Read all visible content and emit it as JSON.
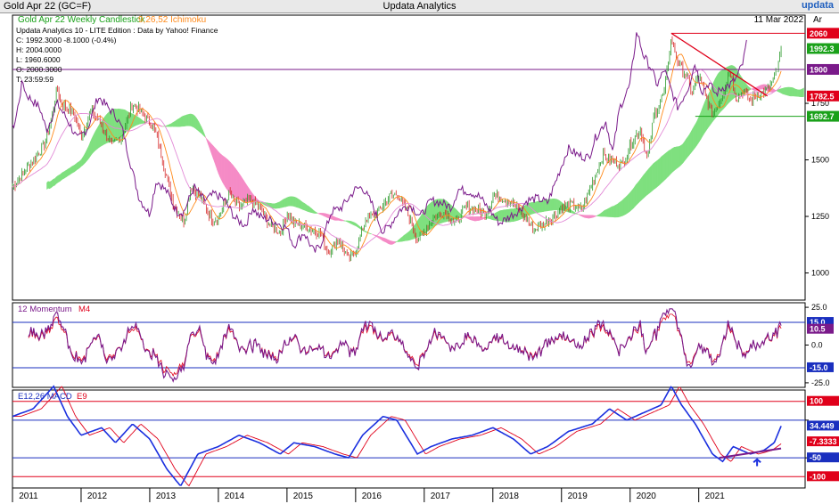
{
  "window": {
    "symbol": "Gold Apr 22 (GC=F)",
    "title": "Updata Analytics",
    "brand": "updata"
  },
  "chart_data": [
    {
      "type": "line",
      "panel": "price",
      "header": {
        "instrument": "Gold Apr 22 Weekly Candlestick",
        "indicator": "9,26,52 Ichimoku",
        "date": "11 Mar 2022",
        "scale_tag": "Ar"
      },
      "info_lines": [
        "Updata Analytics 10 - LITE Edition : Data by Yahoo! Finance",
        "C: 1992.3000  -8.1000 (-0.4%)",
        "H: 2004.0000",
        "L: 1960.6000",
        "O: 2000.3000",
        "T: 23:59:59"
      ],
      "y_ticks": [
        "1750",
        "1500",
        "1250",
        "1000"
      ],
      "y_tick_values": [
        1750,
        1500,
        1250,
        1000
      ],
      "ylim": [
        880,
        2140
      ],
      "markers": [
        {
          "label": "2060",
          "value": 2060,
          "color": "#e0001a"
        },
        {
          "label": "1992.3",
          "value": 1992.3,
          "color": "#1aa11a"
        },
        {
          "label": "1900",
          "value": 1900,
          "color": "#7a1a8a"
        },
        {
          "label": "1782.5",
          "value": 1782.5,
          "color": "#e0001a"
        },
        {
          "label": "1692.7",
          "value": 1692.7,
          "color": "#1aa11a"
        }
      ],
      "horizontal_lines": [
        {
          "value": 1900,
          "color": "#7a1a8a"
        },
        {
          "value": 2060,
          "color": "#e0001a"
        },
        {
          "value": 1692.7,
          "color": "#1aa11a"
        }
      ],
      "price_path": [
        [
          2011.0,
          1380
        ],
        [
          2011.1,
          1420
        ],
        [
          2011.3,
          1500
        ],
        [
          2011.45,
          1560
        ],
        [
          2011.55,
          1650
        ],
        [
          2011.65,
          1820
        ],
        [
          2011.7,
          1760
        ],
        [
          2011.9,
          1700
        ],
        [
          2012.0,
          1600
        ],
        [
          2012.15,
          1720
        ],
        [
          2012.3,
          1650
        ],
        [
          2012.45,
          1560
        ],
        [
          2012.6,
          1610
        ],
        [
          2012.75,
          1750
        ],
        [
          2012.9,
          1700
        ],
        [
          2013.0,
          1670
        ],
        [
          2013.1,
          1610
        ],
        [
          2013.25,
          1420
        ],
        [
          2013.35,
          1300
        ],
        [
          2013.5,
          1230
        ],
        [
          2013.6,
          1380
        ],
        [
          2013.75,
          1330
        ],
        [
          2013.9,
          1240
        ],
        [
          2014.0,
          1240
        ],
        [
          2014.15,
          1350
        ],
        [
          2014.3,
          1290
        ],
        [
          2014.45,
          1320
        ],
        [
          2014.6,
          1290
        ],
        [
          2014.75,
          1210
        ],
        [
          2014.9,
          1180
        ],
        [
          2015.0,
          1260
        ],
        [
          2015.1,
          1220
        ],
        [
          2015.3,
          1200
        ],
        [
          2015.5,
          1170
        ],
        [
          2015.6,
          1090
        ],
        [
          2015.75,
          1150
        ],
        [
          2015.9,
          1060
        ],
        [
          2016.0,
          1100
        ],
        [
          2016.15,
          1240
        ],
        [
          2016.3,
          1260
        ],
        [
          2016.5,
          1340
        ],
        [
          2016.6,
          1350
        ],
        [
          2016.75,
          1270
        ],
        [
          2016.9,
          1150
        ],
        [
          2017.0,
          1180
        ],
        [
          2017.15,
          1250
        ],
        [
          2017.3,
          1270
        ],
        [
          2017.45,
          1220
        ],
        [
          2017.6,
          1290
        ],
        [
          2017.75,
          1280
        ],
        [
          2017.9,
          1260
        ],
        [
          2018.0,
          1340
        ],
        [
          2018.15,
          1330
        ],
        [
          2018.3,
          1310
        ],
        [
          2018.45,
          1250
        ],
        [
          2018.6,
          1190
        ],
        [
          2018.75,
          1220
        ],
        [
          2018.9,
          1250
        ],
        [
          2019.0,
          1290
        ],
        [
          2019.15,
          1300
        ],
        [
          2019.3,
          1280
        ],
        [
          2019.45,
          1400
        ],
        [
          2019.6,
          1520
        ],
        [
          2019.75,
          1490
        ],
        [
          2019.9,
          1480
        ],
        [
          2020.0,
          1570
        ],
        [
          2020.15,
          1640
        ],
        [
          2020.25,
          1500
        ],
        [
          2020.35,
          1700
        ],
        [
          2020.5,
          1800
        ],
        [
          2020.6,
          2040
        ],
        [
          2020.7,
          1930
        ],
        [
          2020.8,
          1880
        ],
        [
          2020.9,
          1800
        ],
        [
          2021.0,
          1870
        ],
        [
          2021.1,
          1780
        ],
        [
          2021.2,
          1700
        ],
        [
          2021.35,
          1790
        ],
        [
          2021.45,
          1900
        ],
        [
          2021.55,
          1770
        ],
        [
          2021.65,
          1810
        ],
        [
          2021.75,
          1760
        ],
        [
          2021.85,
          1790
        ],
        [
          2021.95,
          1800
        ],
        [
          2022.05,
          1830
        ],
        [
          2022.15,
          1900
        ],
        [
          2022.2,
          1992
        ]
      ],
      "xlim": [
        2011.0,
        2022.55
      ]
    },
    {
      "type": "line",
      "panel": "momentum",
      "header": {
        "indicator": "12 Momentum",
        "signal": "M4"
      },
      "y_ticks": [
        "25.0",
        "0.0",
        "-25.0"
      ],
      "y_tick_values": [
        25,
        0,
        -25
      ],
      "ylim": [
        -28,
        28
      ],
      "markers": [
        {
          "label": "15.0",
          "value": 15,
          "color": "#1a2fbf"
        },
        {
          "label": "10.5",
          "value": 10.5,
          "color": "#7a1a8a"
        },
        {
          "label": "-15.0",
          "value": -15,
          "color": "#1a2fbf"
        }
      ],
      "horizontal_lines": [
        {
          "value": 15,
          "color": "#1a2fbf"
        },
        {
          "value": -15,
          "color": "#1a2fbf"
        }
      ]
    },
    {
      "type": "line",
      "panel": "macd",
      "header": {
        "indicator": "E12,26 MACD",
        "signal": "E9"
      },
      "y_ticks": [
        "50",
        "-50"
      ],
      "y_tick_values": [
        50,
        -50
      ],
      "ylim": [
        -130,
        130
      ],
      "markers": [
        {
          "label": "100",
          "value": 100,
          "color": "#e0001a"
        },
        {
          "label": "34.449",
          "value": 34.449,
          "color": "#1a2fbf"
        },
        {
          "label": "-7.3333",
          "value": -7.3333,
          "color": "#e0001a"
        },
        {
          "label": "-50",
          "value": -50,
          "color": "#1a2fbf"
        },
        {
          "label": "-100",
          "value": -100,
          "color": "#e0001a"
        }
      ],
      "horizontal_lines": [
        {
          "value": 100,
          "color": "#e0001a"
        },
        {
          "value": 50,
          "color": "#1a2fbf"
        },
        {
          "value": -50,
          "color": "#1a2fbf"
        },
        {
          "value": -100,
          "color": "#e0001a"
        }
      ],
      "macd_path": [
        [
          2011.0,
          60
        ],
        [
          2011.3,
          80
        ],
        [
          2011.6,
          140
        ],
        [
          2011.8,
          60
        ],
        [
          2012.0,
          10
        ],
        [
          2012.3,
          30
        ],
        [
          2012.5,
          -10
        ],
        [
          2012.75,
          40
        ],
        [
          2013.0,
          0
        ],
        [
          2013.25,
          -80
        ],
        [
          2013.45,
          -125
        ],
        [
          2013.7,
          -40
        ],
        [
          2014.0,
          -20
        ],
        [
          2014.3,
          10
        ],
        [
          2014.6,
          -10
        ],
        [
          2014.9,
          -40
        ],
        [
          2015.1,
          -10
        ],
        [
          2015.4,
          -20
        ],
        [
          2015.7,
          -40
        ],
        [
          2015.9,
          -50
        ],
        [
          2016.1,
          10
        ],
        [
          2016.4,
          60
        ],
        [
          2016.6,
          50
        ],
        [
          2016.9,
          -40
        ],
        [
          2017.1,
          -20
        ],
        [
          2017.4,
          0
        ],
        [
          2017.7,
          10
        ],
        [
          2018.0,
          30
        ],
        [
          2018.3,
          0
        ],
        [
          2018.55,
          -40
        ],
        [
          2018.8,
          -20
        ],
        [
          2019.1,
          20
        ],
        [
          2019.45,
          40
        ],
        [
          2019.7,
          80
        ],
        [
          2019.95,
          50
        ],
        [
          2020.2,
          70
        ],
        [
          2020.45,
          90
        ],
        [
          2020.6,
          140
        ],
        [
          2020.75,
          90
        ],
        [
          2020.95,
          40
        ],
        [
          2021.2,
          -40
        ],
        [
          2021.35,
          -60
        ],
        [
          2021.5,
          -20
        ],
        [
          2021.75,
          -40
        ],
        [
          2021.95,
          -30
        ],
        [
          2022.1,
          -10
        ],
        [
          2022.2,
          34.4
        ]
      ]
    }
  ],
  "x_axis": {
    "labels": [
      "2011",
      "2012",
      "2013",
      "2014",
      "2015",
      "2016",
      "2017",
      "2018",
      "2019",
      "2020",
      "2021"
    ],
    "values": [
      2011,
      2012,
      2013,
      2014,
      2015,
      2016,
      2017,
      2018,
      2019,
      2020,
      2021
    ]
  }
}
